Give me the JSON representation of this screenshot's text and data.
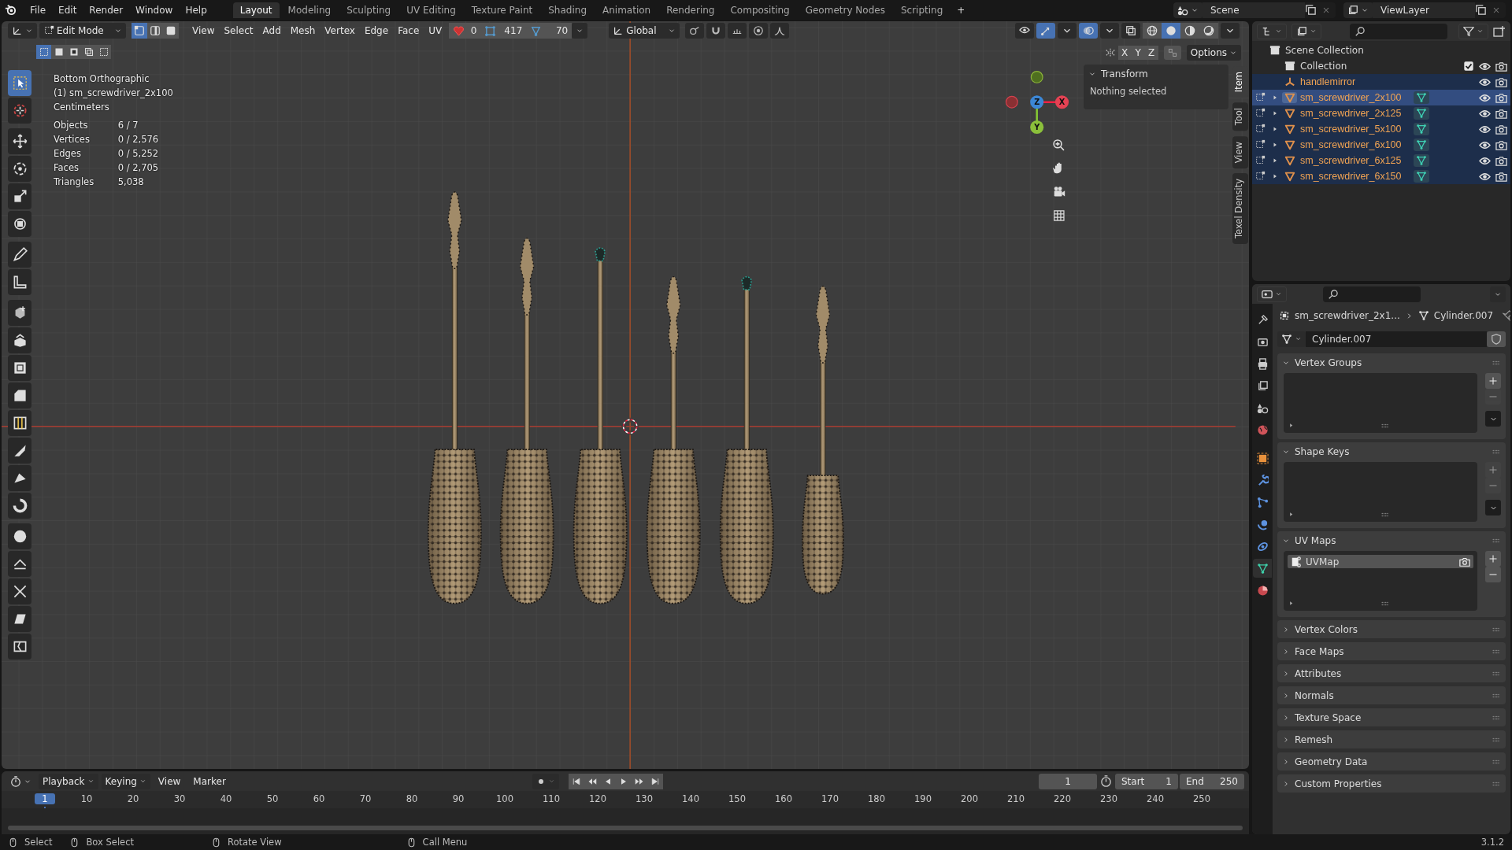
{
  "menu": [
    "File",
    "Edit",
    "Render",
    "Window",
    "Help"
  ],
  "workspaces": [
    {
      "label": "Layout",
      "selected": true
    },
    {
      "label": "Modeling",
      "selected": false
    },
    {
      "label": "Sculpting",
      "selected": false
    },
    {
      "label": "UV Editing",
      "selected": false
    },
    {
      "label": "Texture Paint",
      "selected": false
    },
    {
      "label": "Shading",
      "selected": false
    },
    {
      "label": "Animation",
      "selected": false
    },
    {
      "label": "Rendering",
      "selected": false
    },
    {
      "label": "Compositing",
      "selected": false
    },
    {
      "label": "Geometry Nodes",
      "selected": false
    },
    {
      "label": "Scripting",
      "selected": false
    }
  ],
  "add_workspace": "+",
  "scene": "Scene",
  "view_layer": "ViewLayer",
  "viewport_header": {
    "mode": "Edit Mode",
    "select_modes": [
      {
        "selected": true
      },
      {
        "selected": false
      },
      {
        "selected": false
      }
    ],
    "menus": [
      "View",
      "Select",
      "Add",
      "Mesh",
      "Vertex",
      "Edge",
      "Face",
      "UV"
    ],
    "counts": [
      "0",
      "417",
      "70"
    ],
    "orientation": "Global",
    "gizmos_on": true,
    "overlays_on": true,
    "shading": [
      {
        "selected": false
      },
      {
        "selected": true
      },
      {
        "selected": false
      },
      {
        "selected": false
      }
    ]
  },
  "box_modes": [
    {
      "selected": true
    },
    {
      "selected": false
    },
    {
      "selected": false
    },
    {
      "selected": false
    },
    {
      "selected": false
    }
  ],
  "mirror_axes": [
    "X",
    "Y",
    "Z"
  ],
  "options": "Options",
  "tools": [
    {
      "selected": true
    },
    {
      "selected": false
    },
    {
      "selected": false
    },
    {
      "selected": false
    },
    {
      "selected": false
    },
    {
      "selected": false
    },
    {
      "selected": false
    },
    {
      "selected": false
    },
    {
      "selected": false
    },
    {
      "selected": false
    },
    {
      "selected": false
    },
    {
      "selected": false
    },
    {
      "selected": false
    },
    {
      "selected": false
    },
    {
      "selected": false
    },
    {
      "selected": false
    },
    {
      "selected": false
    },
    {
      "selected": false
    },
    {
      "selected": false
    },
    {
      "selected": false
    },
    {
      "selected": false
    }
  ],
  "viewport_info": {
    "view": "Bottom Orthographic",
    "object": "(1) sm_screwdriver_2x100",
    "units": "Centimeters",
    "stats": [
      {
        "label": "Objects",
        "value": "6 / 7"
      },
      {
        "label": "Vertices",
        "value": "0 / 2,576"
      },
      {
        "label": "Edges",
        "value": "0 / 5,252"
      },
      {
        "label": "Faces",
        "value": "0 / 2,705"
      },
      {
        "label": "Triangles",
        "value": "5,038"
      }
    ]
  },
  "gizmo": {
    "x": "X",
    "y": "Y",
    "z": "Z"
  },
  "n_panel": {
    "title": "Transform",
    "body": "Nothing selected",
    "tabs": [
      {
        "label": "Item",
        "selected": true
      },
      {
        "label": "Tool",
        "selected": false
      },
      {
        "label": "View",
        "selected": false
      },
      {
        "label": "Texel Density",
        "selected": false
      }
    ]
  },
  "outliner": {
    "root": "Scene Collection",
    "collection": {
      "label": "Collection",
      "checked": true
    },
    "objects": [
      {
        "label": "handlemirror",
        "kind": "empty",
        "selected": true,
        "active": false
      },
      {
        "label": "sm_screwdriver_2x100",
        "kind": "mesh",
        "selected": true,
        "active": true
      },
      {
        "label": "sm_screwdriver_2x125",
        "kind": "mesh",
        "selected": true,
        "active": false
      },
      {
        "label": "sm_screwdriver_5x100",
        "kind": "mesh",
        "selected": true,
        "active": false
      },
      {
        "label": "sm_screwdriver_6x100",
        "kind": "mesh",
        "selected": true,
        "active": false
      },
      {
        "label": "sm_screwdriver_6x125",
        "kind": "mesh",
        "selected": true,
        "active": false
      },
      {
        "label": "sm_screwdriver_6x150",
        "kind": "mesh",
        "selected": true,
        "active": false
      }
    ]
  },
  "properties": {
    "tabs": [
      {
        "selected": false
      },
      {
        "selected": false
      },
      {
        "selected": false
      },
      {
        "selected": false
      },
      {
        "selected": false
      },
      {
        "selected": false
      },
      {
        "selected": false
      },
      {
        "selected": false
      },
      {
        "selected": false
      },
      {
        "selected": false
      },
      {
        "selected": false
      },
      {
        "selected": true
      },
      {
        "selected": false
      }
    ],
    "breadcrumb": [
      "sm_screwdriver_2x1...",
      "Cylinder.007"
    ],
    "data_name": "Cylinder.007",
    "panels": [
      {
        "title": "Vertex Groups",
        "expanded": true,
        "add_enabled": true,
        "remove_enabled": false
      },
      {
        "title": "Shape Keys",
        "expanded": true,
        "add_enabled": false,
        "remove_enabled": false
      },
      {
        "title": "UV Maps",
        "expanded": true,
        "add_enabled": true,
        "remove_enabled": true,
        "items": [
          {
            "label": "UVMap",
            "selected": true
          }
        ]
      },
      {
        "title": "Vertex Colors",
        "expanded": false
      },
      {
        "title": "Face Maps",
        "expanded": false
      },
      {
        "title": "Attributes",
        "expanded": false
      },
      {
        "title": "Normals",
        "expanded": false
      },
      {
        "title": "Texture Space",
        "expanded": false
      },
      {
        "title": "Remesh",
        "expanded": false
      },
      {
        "title": "Geometry Data",
        "expanded": false
      },
      {
        "title": "Custom Properties",
        "expanded": false
      }
    ]
  },
  "timeline": {
    "menus": [
      "Playback",
      "Keying",
      "View",
      "Marker"
    ],
    "current_frame": "1",
    "start_label": "Start",
    "start": "1",
    "end_label": "End",
    "end": "250",
    "ticks": [
      {
        "label": "1",
        "selected": true
      },
      {
        "label": "10",
        "selected": false
      },
      {
        "label": "20",
        "selected": false
      },
      {
        "label": "30",
        "selected": false
      },
      {
        "label": "40",
        "selected": false
      },
      {
        "label": "50",
        "selected": false
      },
      {
        "label": "60",
        "selected": false
      },
      {
        "label": "70",
        "selected": false
      },
      {
        "label": "80",
        "selected": false
      },
      {
        "label": "90",
        "selected": false
      },
      {
        "label": "100",
        "selected": false
      },
      {
        "label": "110",
        "selected": false
      },
      {
        "label": "120",
        "selected": false
      },
      {
        "label": "130",
        "selected": false
      },
      {
        "label": "140",
        "selected": false
      },
      {
        "label": "150",
        "selected": false
      },
      {
        "label": "160",
        "selected": false
      },
      {
        "label": "170",
        "selected": false
      },
      {
        "label": "180",
        "selected": false
      },
      {
        "label": "190",
        "selected": false
      },
      {
        "label": "200",
        "selected": false
      },
      {
        "label": "210",
        "selected": false
      },
      {
        "label": "220",
        "selected": false
      },
      {
        "label": "230",
        "selected": false
      },
      {
        "label": "240",
        "selected": false
      },
      {
        "label": "250",
        "selected": false
      }
    ]
  },
  "status_bar": {
    "items": [
      "Select",
      "Box Select",
      "Rotate View",
      "Call Menu"
    ],
    "version": "3.1.2"
  }
}
